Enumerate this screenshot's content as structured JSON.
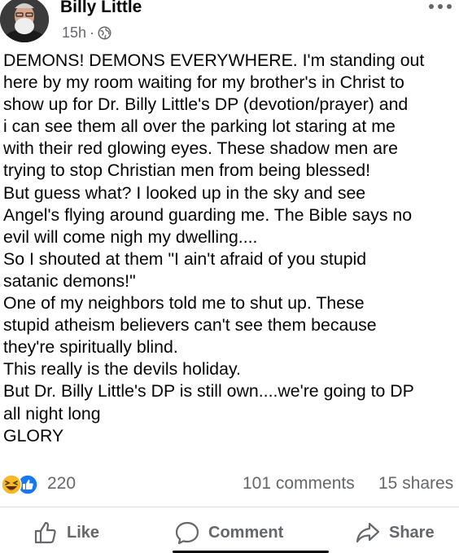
{
  "post": {
    "author": "Billy Little",
    "time": "15h",
    "separator": "·",
    "privacy_icon": "globe-icon",
    "more_icon": "more-dots-icon",
    "lines": [
      "DEMONS! DEMONS EVERYWHERE. I'm standing out",
      "here by my room waiting for my brother's in Christ to",
      "show up for Dr. Billy Little's DP (devotion/prayer) and",
      "i can see them all over the parking lot staring at me",
      "with their red glowing eyes. These shadow men are",
      "trying to stop Christian men from being blessed!",
      "But guess what? I looked up in the sky and see",
      "Angel's flying around guarding me. The Bible says no",
      "evil will come nigh my dwelling....",
      "So I shouted at them \"I ain't afraid of you stupid",
      "satanic demons!\"",
      "One of my neighbors told me to shut up. These",
      "stupid atheism believers can't see them because",
      "they're spiritually blind.",
      "This really is the devils holiday.",
      "But Dr. Billy Little's DP is still own....we're going to DP",
      "all night long",
      "GLORY"
    ]
  },
  "stats": {
    "reaction_icons": [
      "haha-emoji-icon",
      "like-thumb-icon"
    ],
    "reaction_count": "220",
    "comments": "101 comments",
    "shares": "15 shares"
  },
  "actions": {
    "like": "Like",
    "comment": "Comment",
    "share": "Share"
  },
  "colors": {
    "text": "#050505",
    "secondary": "#65676b",
    "like_blue": "#1877f2",
    "haha_yellow": "#f7b928",
    "divider": "#dddfe2"
  }
}
